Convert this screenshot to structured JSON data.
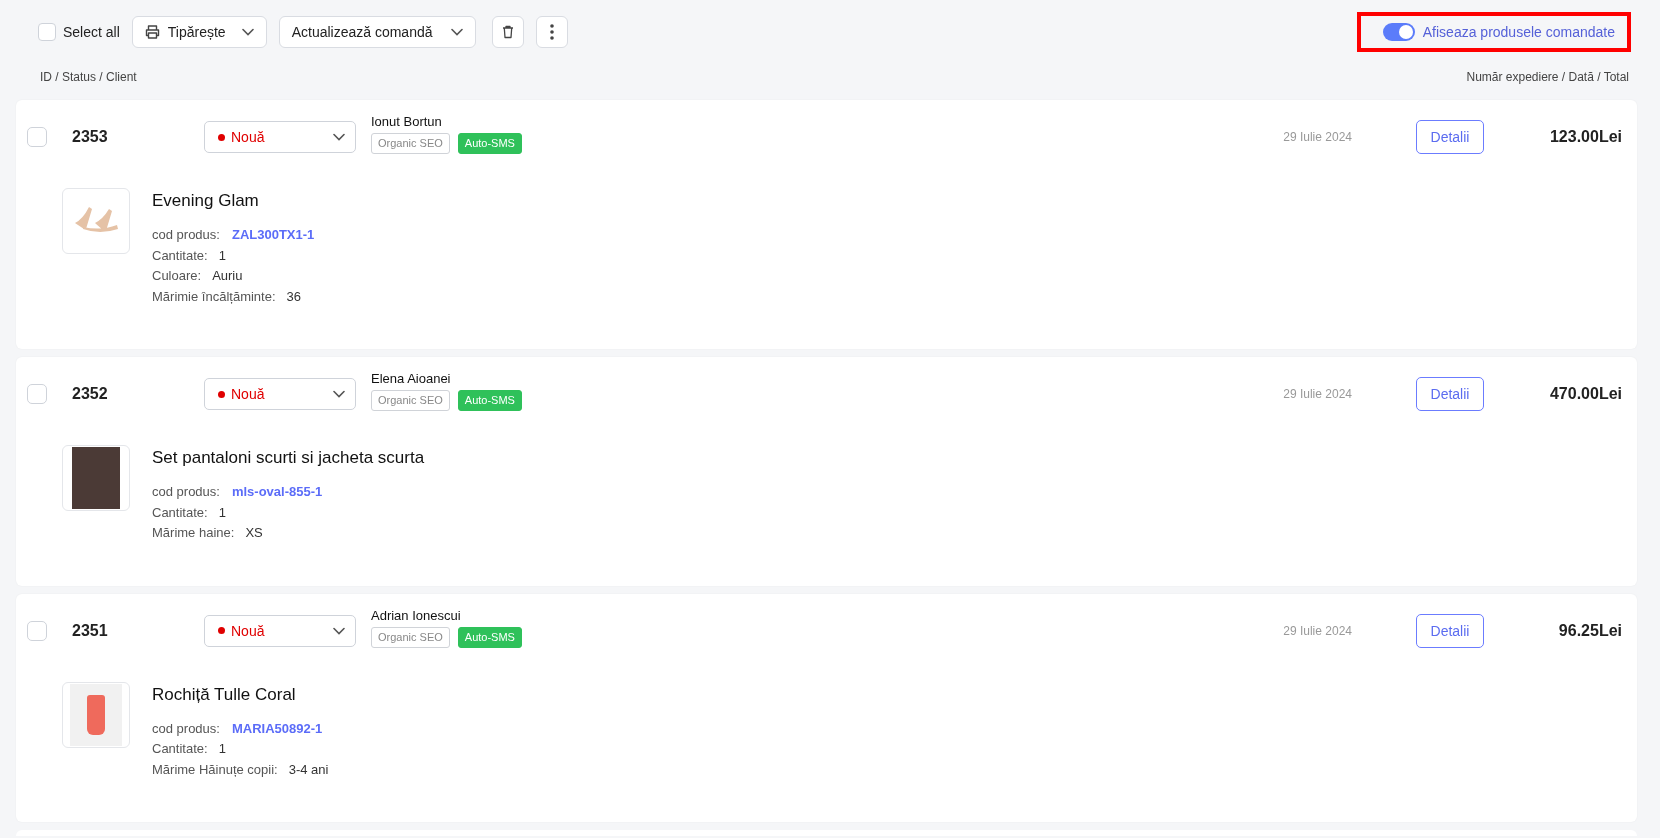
{
  "toolbar": {
    "select_all": {
      "label": "Select all",
      "checked": false
    },
    "print_menu": {
      "label": "Tipărește"
    },
    "update_menu": {
      "label": "Actualizează comandă"
    },
    "toggle": {
      "label": "Afiseaza produsele comandate",
      "on": true,
      "highlighted": true
    }
  },
  "columns": {
    "left": "ID / Status / Client",
    "right": "Număr expediere / Dată / Total"
  },
  "orders": [
    {
      "id": "2353",
      "checked": false,
      "status": "Nouă",
      "client": "Ionut Bortun",
      "tags": [
        {
          "label": "Organic SEO",
          "kind": "outline"
        },
        {
          "label": "Auto-SMS",
          "kind": "filled"
        }
      ],
      "date": "29 Iulie 2024",
      "details_button": "Detalii",
      "total": "123.00Lei",
      "product": {
        "name": "Evening Glam",
        "kind": "shoes",
        "attributes": [
          {
            "label": "cod produs:",
            "value": "ZAL300TX1-1",
            "kind": "link"
          },
          {
            "label": "Cantitate:",
            "value": "1",
            "kind": "plain"
          },
          {
            "label": "Culoare:",
            "value": "Auriu",
            "kind": "plain"
          },
          {
            "label": "Mărimie încălțăminte:",
            "value": "36",
            "kind": "plain"
          }
        ]
      }
    },
    {
      "id": "2352",
      "checked": false,
      "status": "Nouă",
      "client": "Elena Aioanei",
      "tags": [
        {
          "label": "Organic SEO",
          "kind": "outline"
        },
        {
          "label": "Auto-SMS",
          "kind": "filled"
        }
      ],
      "date": "29 Iulie 2024",
      "details_button": "Detalii",
      "total": "470.00Lei",
      "product": {
        "name": "Set pantaloni scurti si jacheta scurta",
        "kind": "outfit",
        "attributes": [
          {
            "label": "cod produs:",
            "value": "mls-oval-855-1",
            "kind": "link"
          },
          {
            "label": "Cantitate:",
            "value": "1",
            "kind": "plain"
          },
          {
            "label": "Mărime haine:",
            "value": "XS",
            "kind": "plain"
          }
        ]
      }
    },
    {
      "id": "2351",
      "checked": false,
      "status": "Nouă",
      "client": "Adrian Ionescui",
      "tags": [
        {
          "label": "Organic SEO",
          "kind": "outline"
        },
        {
          "label": "Auto-SMS",
          "kind": "filled"
        }
      ],
      "date": "29 Iulie 2024",
      "details_button": "Detalii",
      "total": "96.25Lei",
      "product": {
        "name": "Rochiță Tulle Coral",
        "kind": "dress",
        "attributes": [
          {
            "label": "cod produs:",
            "value": "MARIA50892-1",
            "kind": "link"
          },
          {
            "label": "Cantitate:",
            "value": "1",
            "kind": "plain"
          },
          {
            "label": "Mărime Hăinuțe copii:",
            "value": "3-4 ani",
            "kind": "plain"
          }
        ]
      }
    }
  ]
}
